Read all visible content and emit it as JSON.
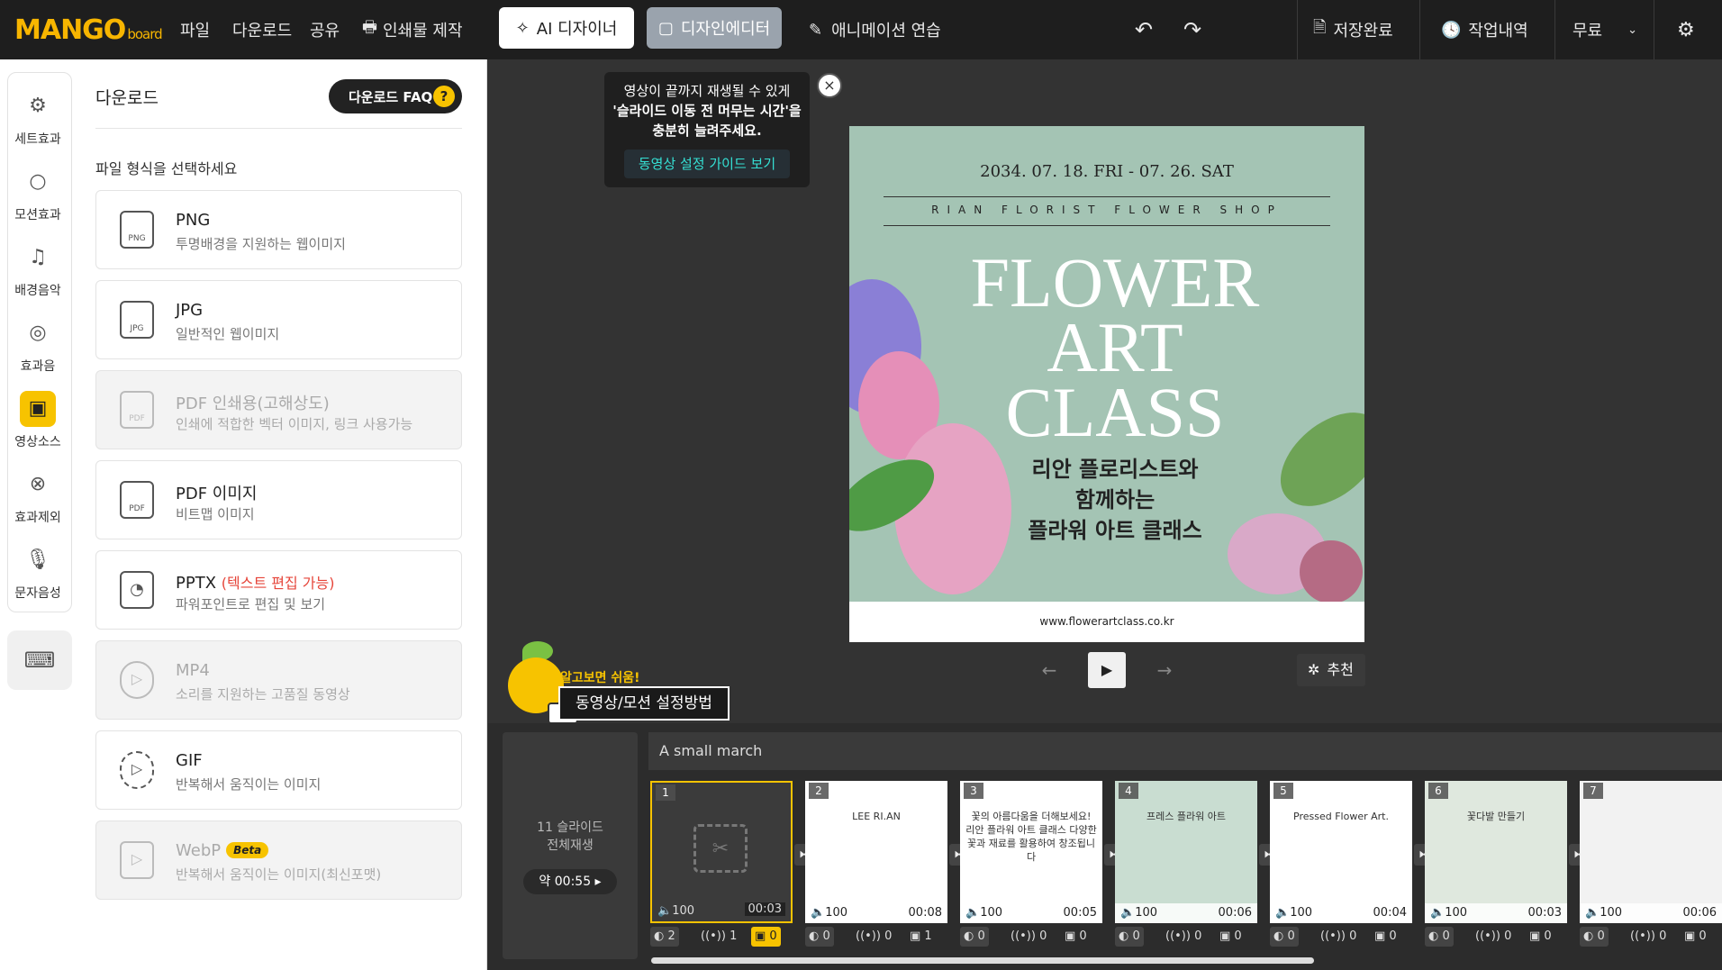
{
  "topbar": {
    "logo_main": "MANGO",
    "logo_sub": "board",
    "menu": [
      "파일",
      "다운로드",
      "공유",
      "인쇄물 제작"
    ],
    "ai_designer": "AI 디자이너",
    "design_editor": "디자인에디터",
    "anim_practice": "애니메이션 연습",
    "save": "저장완료",
    "history": "작업내역",
    "plan": "무료"
  },
  "rail": {
    "items": [
      "세트효과",
      "모션효과",
      "배경음악",
      "효과음",
      "영상소스",
      "효과제외",
      "문자음성"
    ],
    "active_index": 4
  },
  "panel": {
    "title": "다운로드",
    "faq": "다운로드 FAQ",
    "subtitle": "파일 형식을 선택하세요",
    "formats": [
      {
        "name": "PNG",
        "desc": "투명배경을 지원하는 웹이미지",
        "icon": "PNG",
        "disabled": false
      },
      {
        "name": "JPG",
        "desc": "일반적인 웹이미지",
        "icon": "JPG",
        "disabled": false
      },
      {
        "name": "PDF 인쇄용(고해상도)",
        "desc": "인쇄에 적합한 벡터 이미지, 링크 사용가능",
        "icon": "PDF",
        "disabled": true
      },
      {
        "name": "PDF 이미지",
        "desc": "비트맵 이미지",
        "icon": "PDF",
        "disabled": false
      },
      {
        "name": "PPTX",
        "extra": "(텍스트 편집 가능)",
        "desc": "파워포인트로 편집 및 보기",
        "icon": "",
        "disabled": false
      },
      {
        "name": "MP4",
        "desc": "소리를 지원하는 고품질 동영상",
        "icon": "",
        "disabled": true
      },
      {
        "name": "GIF",
        "desc": "반복해서 움직이는 이미지",
        "icon": "",
        "disabled": false
      },
      {
        "name": "WebP",
        "badge": "Beta",
        "desc": "반복해서 움직이는 이미지(최신포맷)",
        "icon": "",
        "disabled": true
      }
    ]
  },
  "tooltip": {
    "line1": "영상이 끝까지 재생될 수 있게",
    "line2": "'슬라이드 이동 전 머무는 시간'을",
    "line3": "충분히 늘려주세요.",
    "button": "동영상 설정 가이드 보기",
    "close": "×"
  },
  "slide": {
    "date": "2034. 07. 18. FRI - 07. 26. SAT",
    "shop": "RIAN FLORIST FLOWER SHOP",
    "big": [
      "FLOWER",
      "ART",
      "CLASS"
    ],
    "korean": [
      "리안 플로리스트와",
      "함께하는",
      "플라워 아트 클래스"
    ],
    "url": "www.flowerartclass.co.kr"
  },
  "controls": {
    "prev": "←",
    "play": "▶",
    "next": "→",
    "recommend": "추천"
  },
  "mascot": {
    "tag": "알고보면 쉬움!",
    "label": "동영상/모션 설정방법"
  },
  "timeline": {
    "slides_count": "11 슬라이드",
    "play_all": "전체재생",
    "duration": "약 00:55 ▸",
    "project": "A small march",
    "thumbs": [
      {
        "num": "1",
        "vol": "100",
        "time": "00:03",
        "s1": "2",
        "s2": "1",
        "s3": "0"
      },
      {
        "num": "2",
        "vol": "100",
        "time": "00:08",
        "s1": "0",
        "s2": "0",
        "s3": "1",
        "title": "LEE RI.AN"
      },
      {
        "num": "3",
        "vol": "100",
        "time": "00:05",
        "s1": "0",
        "s2": "0",
        "s3": "0",
        "title": "꽃의 아름다움을 더해보세요! 리안 플라워 아트 클래스 다양한 꽃과 재료를 활용하여 창조됩니다"
      },
      {
        "num": "4",
        "vol": "100",
        "time": "00:06",
        "s1": "0",
        "s2": "0",
        "s3": "0",
        "title": "프레스 플라워 아트"
      },
      {
        "num": "5",
        "vol": "100",
        "time": "00:04",
        "s1": "0",
        "s2": "0",
        "s3": "0",
        "title": "Pressed Flower Art."
      },
      {
        "num": "6",
        "vol": "100",
        "time": "00:03",
        "s1": "0",
        "s2": "0",
        "s3": "0",
        "title": "꽃다발 만들기"
      },
      {
        "num": "7",
        "vol": "100",
        "time": "00:06",
        "s1": "0",
        "s2": "0",
        "s3": "0",
        "title": ""
      }
    ]
  },
  "colors": {
    "accent": "#f7c300",
    "slide_bg": "#a4c4b4",
    "dark": "#1e1e1e",
    "teal": "#35e0d4"
  }
}
